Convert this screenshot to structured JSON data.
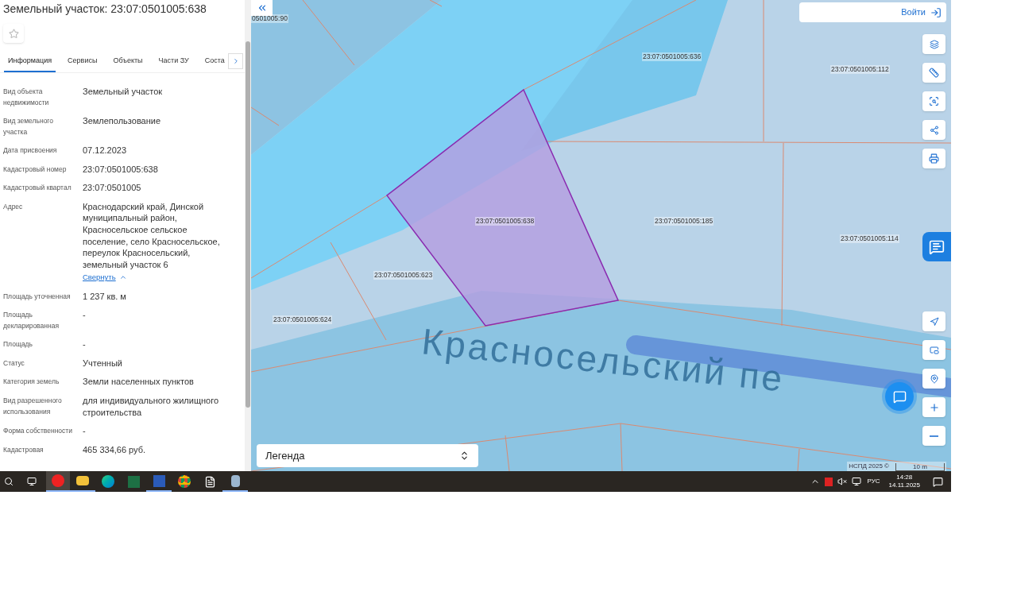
{
  "panel": {
    "title": "Земельный участок: 23:07:0501005:638",
    "favorite": false,
    "tabs": [
      {
        "label": "Информация",
        "selected": true
      },
      {
        "label": "Сервисы",
        "selected": false
      },
      {
        "label": "Объекты",
        "selected": false
      },
      {
        "label": "Части ЗУ",
        "selected": false
      },
      {
        "label": "Соста",
        "selected": false
      }
    ],
    "fields": [
      {
        "label": "Вид объекта недвижимости",
        "value": "Земельный участок"
      },
      {
        "label": "Вид земельного участка",
        "value": "Землепользование"
      },
      {
        "label": "Дата присвоения",
        "value": "07.12.2023"
      },
      {
        "label": "Кадастровый номер",
        "value": "23:07:0501005:638"
      },
      {
        "label": "Кадастровый квартал",
        "value": "23:07:0501005"
      },
      {
        "label": "Адрес",
        "value": "Краснодарский край, Динской муниципальный район, Красносельское сельское поселение, село Красносельское, переулок Красносельский, земельный участок 6",
        "toggle": "Свернуть",
        "expanded": true
      },
      {
        "label": "Площадь уточненная",
        "value": "1 237 кв. м"
      },
      {
        "label": "Площадь декларированная",
        "value": "-"
      },
      {
        "label": "Площадь",
        "value": "-"
      },
      {
        "label": "Статус",
        "value": "Учтенный"
      },
      {
        "label": "Категория земель",
        "value": "Земли населенных пунктов"
      },
      {
        "label": "Вид разрешенного использования",
        "value": "для индивидуального жилищного строительства"
      },
      {
        "label": "Форма собственности",
        "value": "-"
      },
      {
        "label": "Кадастровая",
        "value": "465 334,66 руб."
      }
    ]
  },
  "map": {
    "login": "Войти",
    "parcels": [
      {
        "label": "0501005:90"
      },
      {
        "label": "23:07:0501005:636"
      },
      {
        "label": "23:07:0501005:112"
      },
      {
        "label": "23:07:0501005:638"
      },
      {
        "label": "23:07:0501005:185"
      },
      {
        "label": "23:07:0501005:114"
      },
      {
        "label": "23:07:0501005:623"
      },
      {
        "label": "23:07:0501005:624"
      }
    ],
    "street": "Красносельский пе",
    "legend": "Легенда",
    "attribution": "НСПД 2025 ©",
    "scale": "10 m"
  },
  "taskbar": {
    "language": "РУС",
    "time": "14:28",
    "date": "14.11.2025"
  }
}
